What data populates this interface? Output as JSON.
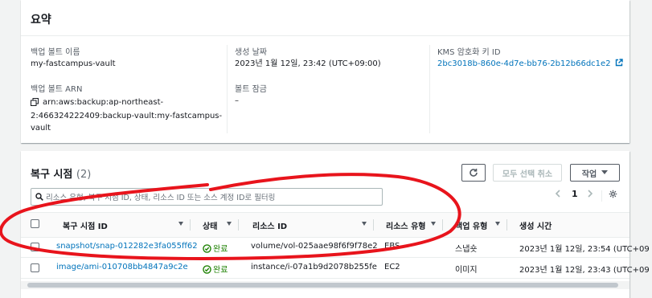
{
  "summary": {
    "title": "요약",
    "vault_name_label": "백업 볼트 이름",
    "vault_name": "my-fastcampus-vault",
    "vault_arn_label": "백업 볼트 ARN",
    "vault_arn_line1": "arn:aws:backup:ap-northeast-",
    "vault_arn_line2": "2:466324222409:backup-vault:my-fastcampus-",
    "vault_arn_line3": "vault",
    "created_label": "생성 날짜",
    "created_value": "2023년 1월 12일, 23:42 (UTC+09:00)",
    "lock_label": "볼트 잠금",
    "lock_value": "–",
    "kms_label": "KMS 암호화 키 ID",
    "kms_value": "2bc3018b-860e-4d7e-bb76-2b12b66dc1e2"
  },
  "recovery": {
    "title": "복구 시점",
    "count": "(2)",
    "deselect_all": "모두 선택 취소",
    "actions": "작업",
    "search_placeholder": "리소스 유형, 복구 지점 ID, 상태, 리소스 ID 또는 소스 계정 ID로 필터링",
    "page": "1",
    "columns": [
      "복구 시점 ID",
      "상태",
      "리소스 ID",
      "리소스 유형",
      "백업 유형",
      "생성 시간"
    ],
    "rows": [
      {
        "id": "snapshot/snap-012282e3fa055ff62",
        "status": "완료",
        "resource_id": "volume/vol-025aae98f6f9f78e2",
        "resource_type": "EBS",
        "backup_type": "스냅숏",
        "created": "2023년 1월 12일, 23:54 (UTC+09"
      },
      {
        "id": "image/ami-010708bb4847a9c2e",
        "status": "완료",
        "resource_id": "instance/i-07a1b9d2078b255fe",
        "resource_type": "EC2",
        "backup_type": "이미지",
        "created": "2023년 1월 12일, 23:43 (UTC+09"
      }
    ]
  },
  "colors": {
    "link": "#0073bb",
    "success": "#1d8102",
    "annotation": "#e8141c"
  },
  "icons": [
    "copy-icon",
    "external-link-icon",
    "refresh-icon",
    "caret-down-icon",
    "search-icon",
    "chevron-left-icon",
    "chevron-right-icon",
    "gear-icon",
    "success-check-icon",
    "sort-icon"
  ]
}
